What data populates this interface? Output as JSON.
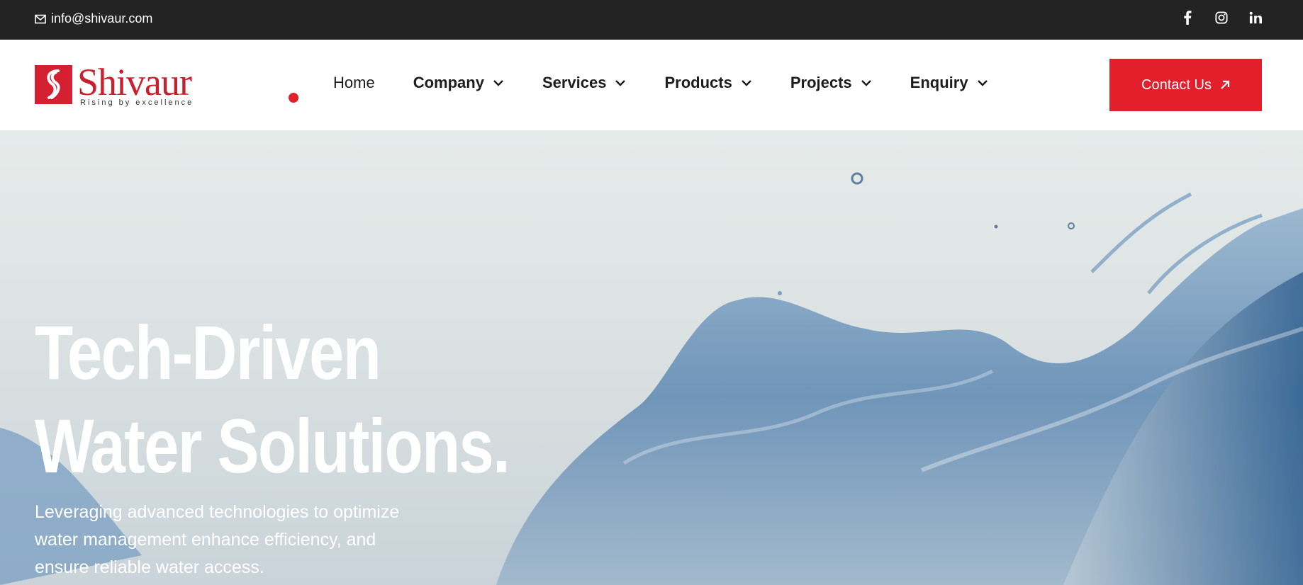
{
  "topbar": {
    "email": "info@shivaur.com",
    "icons": {
      "email": "envelope-icon",
      "facebook": "facebook-icon",
      "instagram": "instagram-icon",
      "linkedin": "linkedin-icon"
    }
  },
  "header": {
    "logo": {
      "name": "Shivaur",
      "tagline": "Rising by excellence"
    },
    "nav": [
      {
        "label": "Home"
      },
      {
        "label": "Company"
      },
      {
        "label": "Services"
      },
      {
        "label": "Products"
      },
      {
        "label": "Projects"
      },
      {
        "label": "Enquiry"
      }
    ],
    "contact_label": "Contact Us"
  },
  "hero": {
    "title_line1": "Tech-Driven",
    "title_line2": "Water Solutions.",
    "subtitle": "Leveraging advanced technologies to optimize water management enhance efficiency, and ensure reliable water access."
  },
  "colors": {
    "accent": "#e21f2b",
    "topbar": "#232323",
    "brand": "#c8202c"
  }
}
